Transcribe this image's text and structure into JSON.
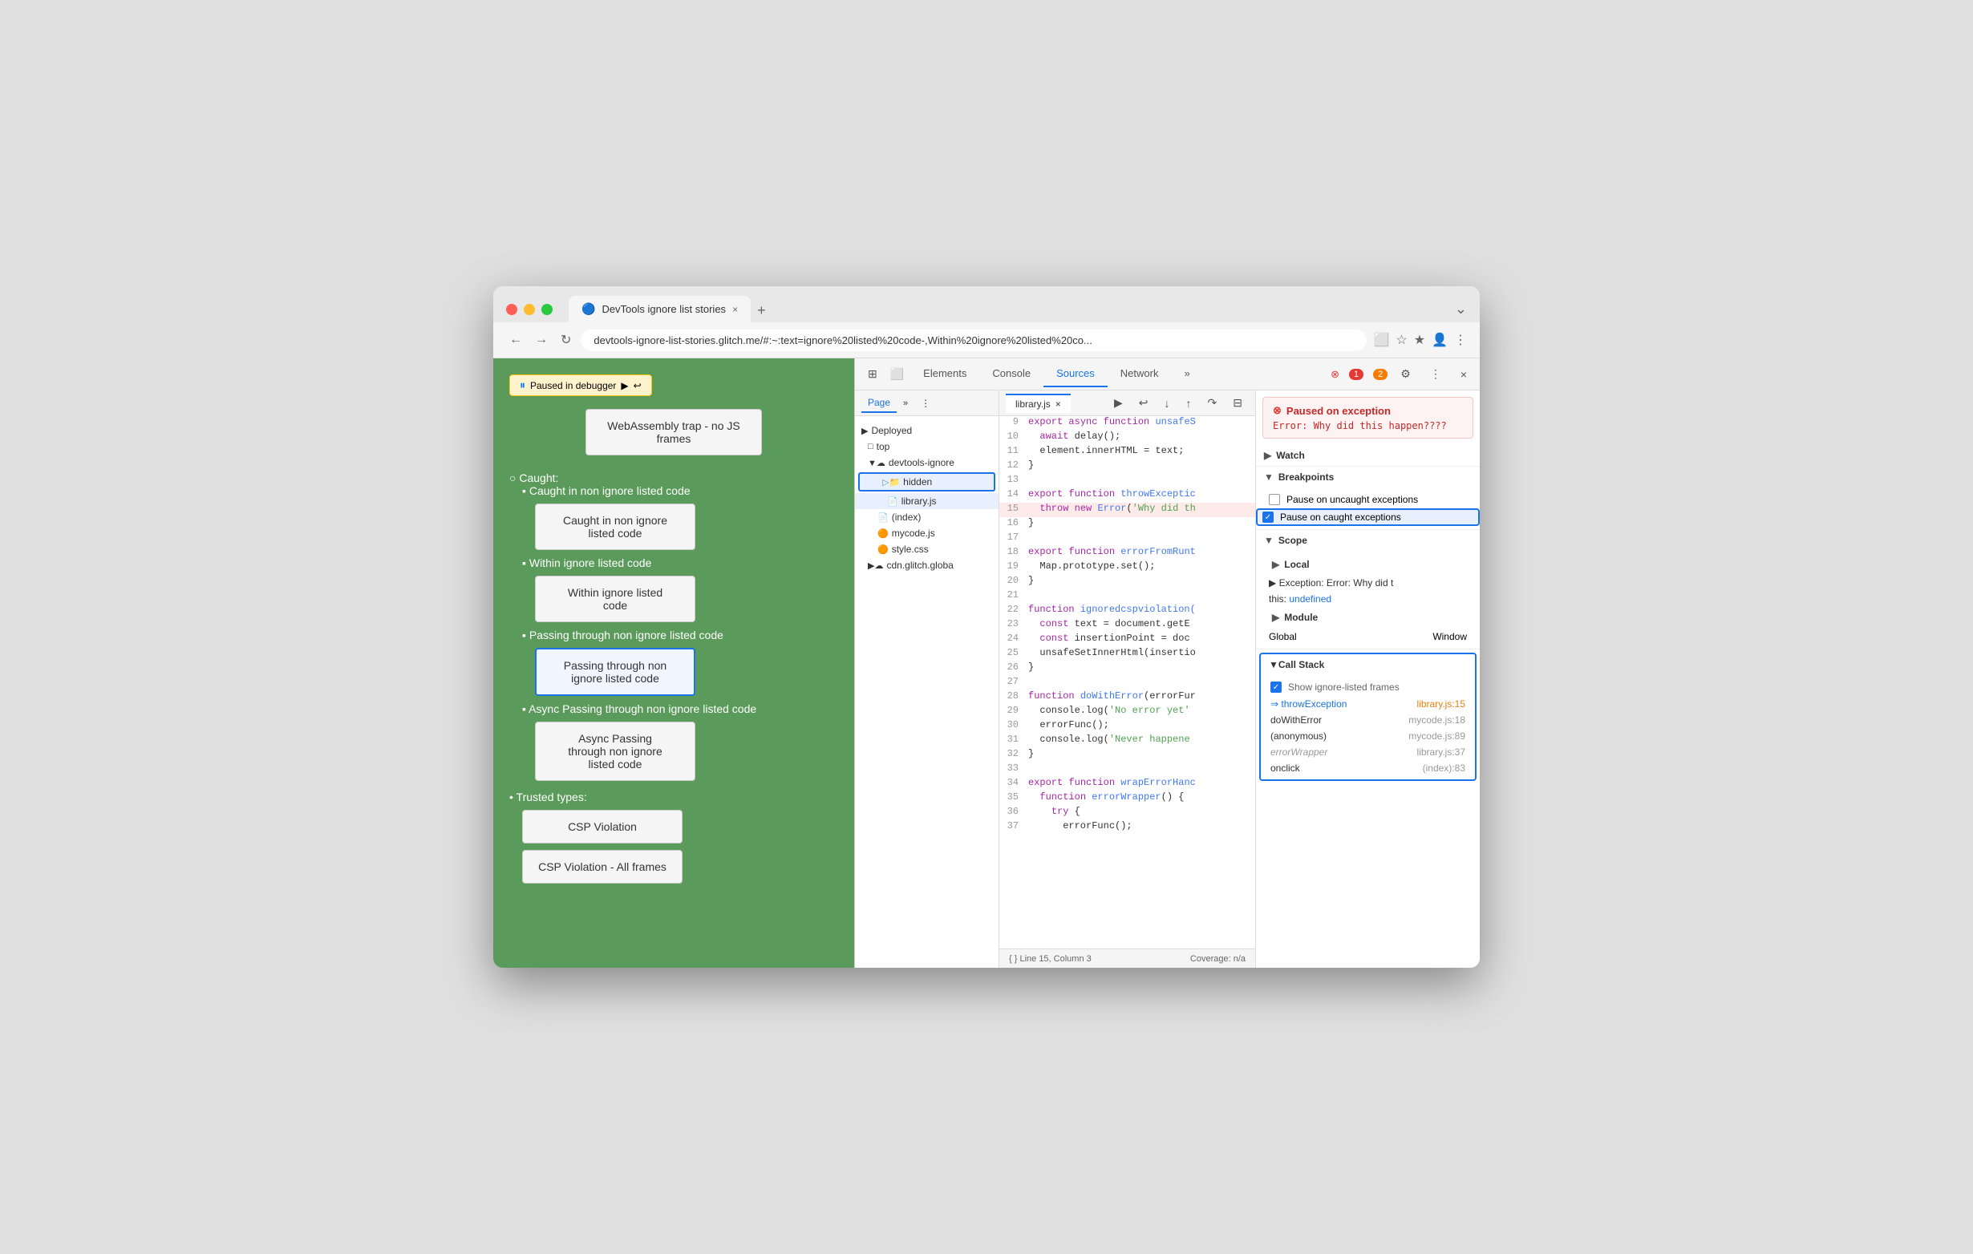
{
  "browser": {
    "title": "DevTools ignore list stories",
    "tab_favicon": "🔵",
    "url": "devtools-ignore-list-stories.glitch.me/#:~:text=ignore%20listed%20code-,Within%20ignore%20listed%20co...",
    "tab_close": "×",
    "tab_add": "+",
    "tab_menu": "⌄"
  },
  "nav": {
    "back": "←",
    "forward": "→",
    "refresh": "↻",
    "address_icons": [
      "⬜",
      "☆",
      "★",
      "🔔",
      "⬜",
      "👤",
      "⋮"
    ]
  },
  "webpage": {
    "paused_badge": "Paused in debugger",
    "webassembly_label": "WebAssembly trap - no JS frames",
    "caught_label": "Caught:",
    "trusted_label": "Trusted types:",
    "items": [
      {
        "bullet": "▪",
        "label": "Caught in non ignore listed code"
      },
      {
        "bullet": "▪",
        "label": "Within ignore listed code"
      },
      {
        "bullet": "▪",
        "label": "Passing through non ignore listed code"
      },
      {
        "bullet": "▪",
        "label": "Async Passing through non ignore listed code"
      }
    ],
    "buttons": [
      {
        "label": "Caught in non ignore listed code",
        "active": false
      },
      {
        "label": "Within ignore listed code",
        "active": false
      },
      {
        "label": "Passing through non ignore listed code",
        "active": true
      },
      {
        "label": "Async Passing through non ignore listed code",
        "active": false
      }
    ],
    "trusted_buttons": [
      {
        "label": "CSP Violation"
      },
      {
        "label": "CSP Violation - All frames"
      }
    ]
  },
  "devtools": {
    "toolbar_icons": [
      "⊞",
      "⬜"
    ],
    "tabs": [
      "Elements",
      "Console",
      "Sources",
      "Network",
      "»"
    ],
    "active_tab": "Sources",
    "error_count": "1",
    "warn_count": "2",
    "gear_icon": "⚙",
    "more_icon": "⋮",
    "close_icon": "×"
  },
  "sources": {
    "page_tab": "Page",
    "more_icon": "»",
    "menu_icon": "⋮",
    "panel_icon": "⬜",
    "file_tab_label": "library.js",
    "file_tab_close": "×",
    "nav_icons": [
      "▶",
      "↩",
      "↓",
      "↑",
      "↷",
      "⊟"
    ]
  },
  "file_tree": {
    "items": [
      {
        "indent": 0,
        "type": "heading",
        "label": "Deployed",
        "icon": ""
      },
      {
        "indent": 1,
        "type": "folder",
        "label": "top",
        "icon": "▷"
      },
      {
        "indent": 1,
        "type": "cloud-folder",
        "label": "devtools-ignore",
        "icon": "▼☁"
      },
      {
        "indent": 2,
        "type": "folder-hidden",
        "label": "hidden",
        "icon": "▷📁",
        "highlighted": true
      },
      {
        "indent": 3,
        "type": "file",
        "label": "library.js",
        "icon": "📄",
        "selected": true
      },
      {
        "indent": 2,
        "type": "file",
        "label": "(index)",
        "icon": "📄"
      },
      {
        "indent": 2,
        "type": "file",
        "label": "mycode.js",
        "icon": "🟠"
      },
      {
        "indent": 2,
        "type": "file",
        "label": "style.css",
        "icon": "🟠"
      },
      {
        "indent": 1,
        "type": "cloud-folder",
        "label": "cdn.glitch.globa",
        "icon": "▶☁"
      }
    ]
  },
  "code": {
    "lines": [
      {
        "num": "9",
        "content": "export async function unsafeS",
        "highlight": false
      },
      {
        "num": "10",
        "content": "  await delay();",
        "highlight": false
      },
      {
        "num": "11",
        "content": "  element.innerHTML = text;",
        "highlight": false
      },
      {
        "num": "12",
        "content": "}",
        "highlight": false
      },
      {
        "num": "13",
        "content": "",
        "highlight": false
      },
      {
        "num": "14",
        "content": "export function throwExceptic",
        "highlight": false
      },
      {
        "num": "15",
        "content": "  throw new Error('Why did th",
        "highlight": true
      },
      {
        "num": "16",
        "content": "}",
        "highlight": false
      },
      {
        "num": "17",
        "content": "",
        "highlight": false
      },
      {
        "num": "18",
        "content": "export function errorFromRunt",
        "highlight": false
      },
      {
        "num": "19",
        "content": "  Map.prototype.set();",
        "highlight": false
      },
      {
        "num": "20",
        "content": "}",
        "highlight": false
      },
      {
        "num": "21",
        "content": "",
        "highlight": false
      },
      {
        "num": "22",
        "content": "function ignoredcspviolation(",
        "highlight": false
      },
      {
        "num": "23",
        "content": "  const text = document.getE",
        "highlight": false
      },
      {
        "num": "24",
        "content": "  const insertionPoint = doc",
        "highlight": false
      },
      {
        "num": "25",
        "content": "  unsafeSetInnerHtml(insertio",
        "highlight": false
      },
      {
        "num": "26",
        "content": "}",
        "highlight": false
      },
      {
        "num": "27",
        "content": "",
        "highlight": false
      },
      {
        "num": "28",
        "content": "function doWithError(errorFur",
        "highlight": false
      },
      {
        "num": "29",
        "content": "  console.log('No error yet'",
        "highlight": false
      },
      {
        "num": "30",
        "content": "  errorFunc();",
        "highlight": false
      },
      {
        "num": "31",
        "content": "  console.log('Never happene",
        "highlight": false
      },
      {
        "num": "32",
        "content": "}",
        "highlight": false
      },
      {
        "num": "33",
        "content": "",
        "highlight": false
      },
      {
        "num": "34",
        "content": "export function wrapErrorHanc",
        "highlight": false
      },
      {
        "num": "35",
        "content": "  function errorWrapper() {",
        "highlight": false
      },
      {
        "num": "36",
        "content": "    try {",
        "highlight": false
      },
      {
        "num": "37",
        "content": "      errorFunc();",
        "highlight": false
      }
    ],
    "status_left": "{ }  Line 15, Column 3",
    "status_right": "Coverage: n/a"
  },
  "debugger": {
    "exception_title": "Paused on exception",
    "exception_msg": "Error: Why did this\nhappen????",
    "sections": {
      "watch": "Watch",
      "breakpoints": "Breakpoints",
      "scope": "Scope",
      "call_stack": "Call Stack"
    },
    "breakpoints": [
      {
        "label": "Pause on uncaught exceptions",
        "checked": false
      },
      {
        "label": "Pause on caught exceptions",
        "checked": true,
        "outlined": true
      }
    ],
    "scope": {
      "local_label": "Local",
      "exception_label": "Exception: Error: Why did t",
      "this_label": "this:",
      "this_val": "undefined",
      "module_label": "Module",
      "global_label": "Global",
      "global_val": "Window"
    },
    "call_stack": {
      "show_frames_label": "Show ignore-listed frames",
      "show_frames_checked": true,
      "frames": [
        {
          "name": "throwException",
          "location": "library.js:15",
          "active": true,
          "italic": false
        },
        {
          "name": "doWithError",
          "location": "mycode.js:18",
          "active": false,
          "italic": false
        },
        {
          "name": "(anonymous)",
          "location": "mycode.js:89",
          "active": false,
          "italic": false
        },
        {
          "name": "errorWrapper",
          "location": "library.js:37",
          "active": false,
          "italic": true
        },
        {
          "name": "onclick",
          "location": "(index):83",
          "active": false,
          "italic": false
        }
      ]
    }
  }
}
